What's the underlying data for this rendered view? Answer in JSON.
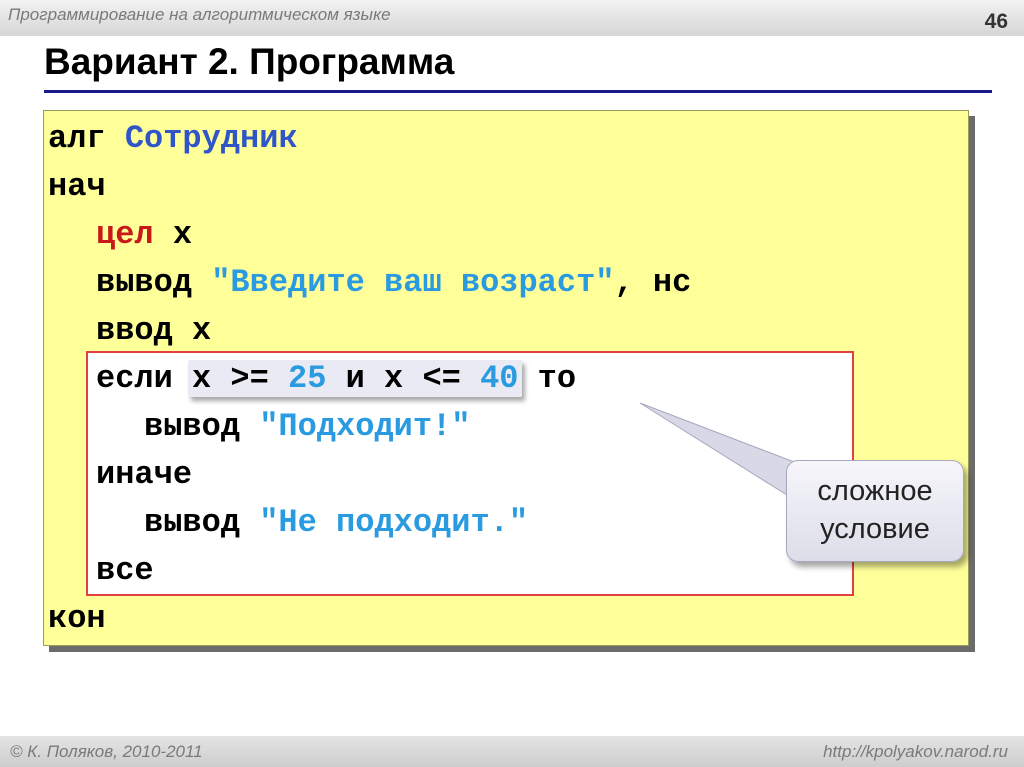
{
  "header": {
    "course": "Программирование на алгоритмическом языке",
    "page_number": "46"
  },
  "title": "Вариант 2. Программа",
  "code": {
    "l1_kw": "алг",
    "l1_name": "Сотрудник",
    "l2_kw": "нач",
    "l3_kw": "цел",
    "l3_var": "x",
    "l4_kw": "вывод",
    "l4_str": "\"Введите ваш возраст\"",
    "l4_sep": ",",
    "l4_nc": "нс",
    "l5_kw": "ввод",
    "l5_var": "x",
    "l6_kw": "если",
    "cond_var1": "x",
    "cond_op1": ">=",
    "cond_num1": "25",
    "cond_and": "и",
    "cond_var2": "x",
    "cond_op2": "<=",
    "cond_num2": "40",
    "l6_to": "то",
    "l7_kw": "вывод",
    "l7_str": "\"Подходит!\"",
    "l8_kw": "иначе",
    "l9_kw": "вывод",
    "l9_str": "\"Не подходит.\"",
    "l10_kw": "все",
    "l11_kw": "кон"
  },
  "callout": {
    "line1": "сложное",
    "line2": "условие"
  },
  "footer": {
    "copyright": "© К. Поляков, 2010-2011",
    "site": "http://kpolyakov.narod.ru"
  },
  "colors": {
    "code_bg": "#ffff99",
    "keyword_blue": "#2f55c9",
    "keyword_red": "#c91818",
    "literal": "#2a9be0",
    "frame": "#e04040",
    "title_rule": "#1a1a8c"
  }
}
